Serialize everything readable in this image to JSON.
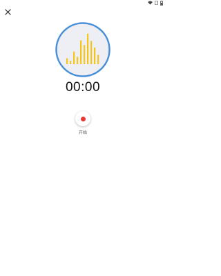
{
  "status_bar": {
    "icons": [
      "wifi-icon",
      "sim-icon",
      "battery-icon"
    ]
  },
  "toolbar": {
    "close_icon": "close-icon"
  },
  "visualizer": {
    "ring_color": "#4a90d9",
    "fill_color": "#eeeef5",
    "bar_color": "#f5c518",
    "bar_levels": [
      0.18,
      0.1,
      0.38,
      0.22,
      0.72,
      0.58,
      0.92,
      0.7,
      0.5,
      0.28
    ]
  },
  "recorder": {
    "timer": "00:00",
    "record_label": "开始",
    "record_color": "#e53935"
  }
}
